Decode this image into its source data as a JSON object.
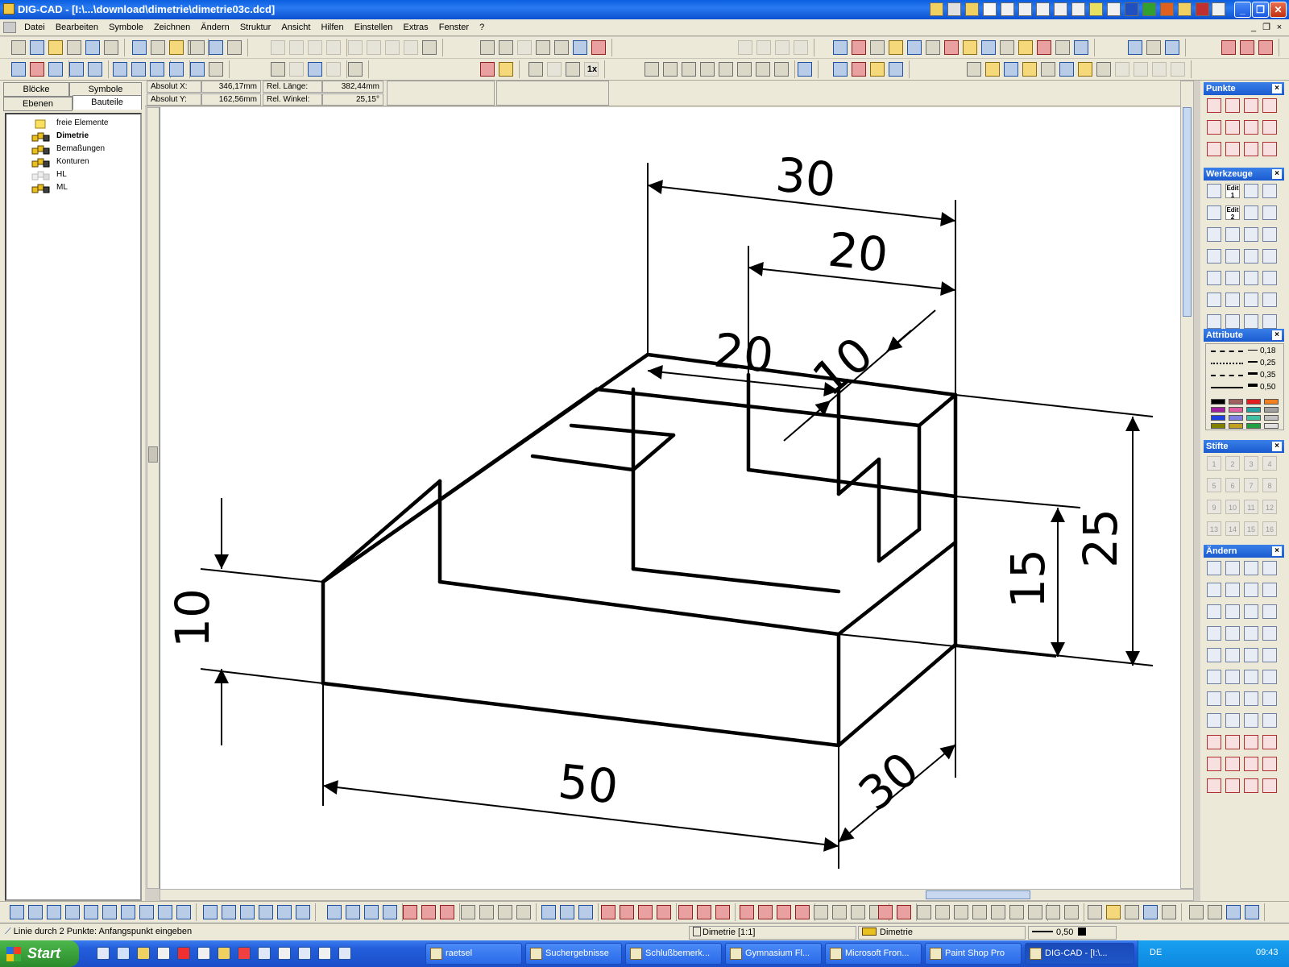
{
  "window": {
    "title": "DIG-CAD - [I:\\...\\download\\dimetrie\\dimetrie03c.dcd]",
    "minimize_label": "_",
    "restore_label": "❐",
    "close_label": "✕",
    "doc_minimize_label": "_",
    "doc_restore_label": "❐",
    "doc_close_label": "×"
  },
  "menu": [
    "Datei",
    "Bearbeiten",
    "Symbole",
    "Zeichnen",
    "Ändern",
    "Struktur",
    "Ansicht",
    "Hilfen",
    "Einstellen",
    "Extras",
    "Fenster",
    "?"
  ],
  "left_panel": {
    "tabs": [
      "Blöcke",
      "Symbole",
      "Ebenen",
      "Bauteile"
    ],
    "active_tab": "Bauteile",
    "tree": [
      {
        "label": "freie Elemente",
        "bold": false
      },
      {
        "label": "Dimetrie",
        "bold": true
      },
      {
        "label": "Bemaßungen",
        "bold": false
      },
      {
        "label": "Konturen",
        "bold": false
      },
      {
        "label": "HL",
        "bold": false
      },
      {
        "label": "ML",
        "bold": false
      }
    ]
  },
  "coords": {
    "abs_x_label": "Absolut X:",
    "abs_x_value": "346,17mm",
    "abs_y_label": "Absolut Y:",
    "abs_y_value": "162,56mm",
    "rel_len_label": "Rel. Länge:",
    "rel_len_value": "382,44mm",
    "rel_angle_label": "Rel. Winkel:",
    "rel_angle_value": "25,15°"
  },
  "drawing": {
    "dims": {
      "top_total": "30",
      "top_inner": "20",
      "slot_depth": "20",
      "slot_width": "10",
      "left_height": "10",
      "bottom_len": "50",
      "bottom_depth": "30",
      "right_inner": "15",
      "right_total": "25"
    }
  },
  "toolbar": {
    "zoom_1x": "1x"
  },
  "right_panel": {
    "punkte": "Punkte",
    "werkzeuge": "Werkzeuge",
    "edit1": "Edit 1",
    "edit2": "Edit 2",
    "attribute": "Attribute",
    "stifte": "Stifte",
    "aendern": "Ändern",
    "line_widths": [
      "0,18",
      "0,25",
      "0,35",
      "0,50"
    ],
    "palette": [
      "#000000",
      "#a06060",
      "#e02020",
      "#f08020",
      "#a020a0",
      "#e060a0",
      "#20a0a0",
      "#a0a0a0",
      "#2040e0",
      "#8080e0",
      "#40c0a0",
      "#c0c0c0",
      "#808000",
      "#c0a020",
      "#20a040",
      "#e0e0e0"
    ],
    "pens": [
      "1",
      "2",
      "3",
      "4",
      "5",
      "6",
      "7",
      "8",
      "9",
      "10",
      "11",
      "12",
      "13",
      "14",
      "15",
      "16"
    ],
    "close_label": "×"
  },
  "status": {
    "hint": "Linie durch 2 Punkte: Anfangspunkt eingeben",
    "scale": "Dimetrie [1:1]",
    "layer": "Dimetrie",
    "line_width": "0,50"
  },
  "taskbar": {
    "start": "Start",
    "items": [
      "raetsel",
      "Suchergebnisse",
      "Schlußbemerk...",
      "Gymnasium Fl...",
      "Microsoft Fron...",
      "Paint Shop Pro",
      "DIG-CAD - [I:\\..."
    ],
    "active": "DIG-CAD - [I:\\...",
    "lang": "DE",
    "clock": "09:43"
  }
}
